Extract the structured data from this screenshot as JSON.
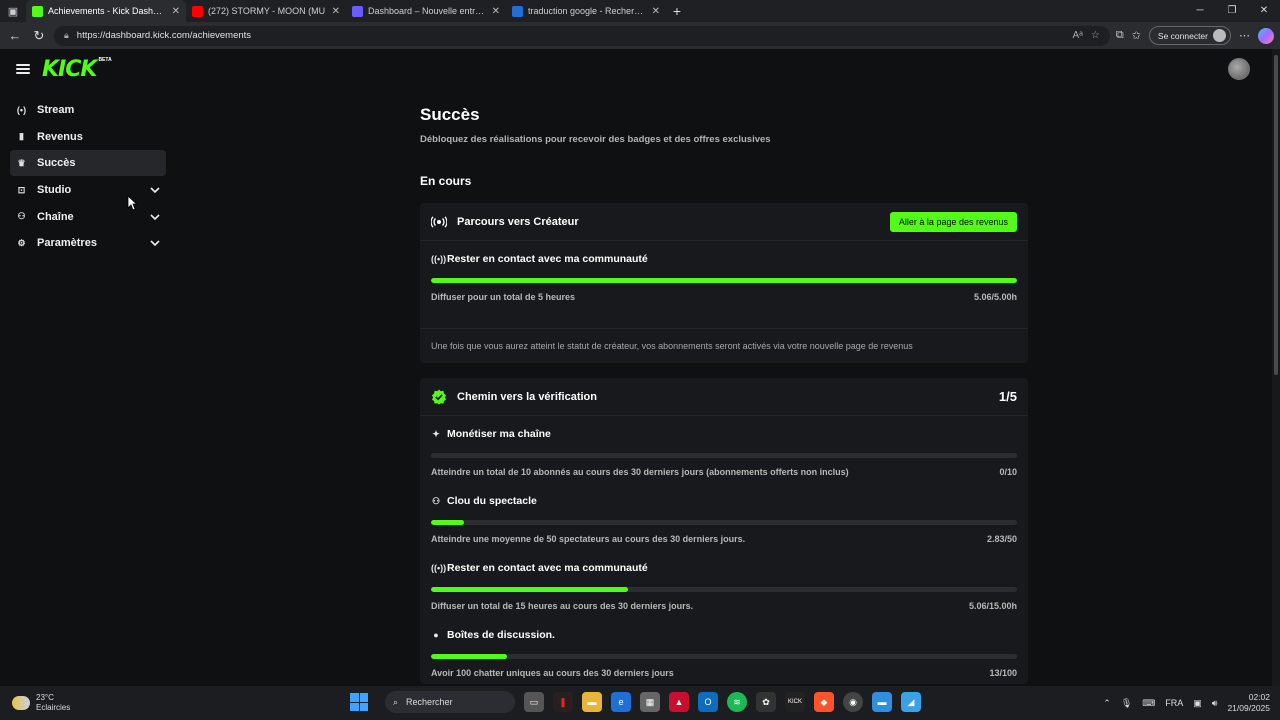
{
  "browser": {
    "tabs": [
      {
        "title": "Achievements - Kick Dashboard",
        "favicon_color": "#53fc18",
        "active": true
      },
      {
        "title": "(272) STORMY - MOON (MU",
        "favicon_color": "#ff0000",
        "active": false
      },
      {
        "title": "Dashboard – Nouvelle entreprise",
        "favicon_color": "#6b5cff",
        "active": false
      },
      {
        "title": "traduction google - Recherche",
        "favicon_color": "#1f6fd6",
        "active": false
      }
    ],
    "url": "https://dashboard.kick.com/achievements",
    "connect_label": "Se connecter"
  },
  "header": {
    "logo": "KICK",
    "logo_badge": "BETA"
  },
  "sidebar": {
    "items": [
      {
        "label": "Stream",
        "icon": "broadcast-icon",
        "glyph": "(•)",
        "active": false,
        "expandable": false
      },
      {
        "label": "Revenus",
        "icon": "chart-icon",
        "glyph": "▮",
        "active": false,
        "expandable": false
      },
      {
        "label": "Succès",
        "icon": "trophy-icon",
        "glyph": "♛",
        "active": true,
        "expandable": false
      },
      {
        "label": "Studio",
        "icon": "studio-icon",
        "glyph": "⊡",
        "active": false,
        "expandable": true
      },
      {
        "label": "Chaîne",
        "icon": "users-icon",
        "glyph": "⚇",
        "active": false,
        "expandable": true
      },
      {
        "label": "Paramètres",
        "icon": "gear-icon",
        "glyph": "⚙",
        "active": false,
        "expandable": true
      }
    ]
  },
  "main": {
    "title": "Succès",
    "subtitle": "Débloquez des réalisations pour recevoir des badges et des offres exclusives",
    "section_title": "En cours",
    "cards": [
      {
        "title": "Parcours vers Créateur",
        "icon": "broadcast-icon",
        "button": "Aller à la page des revenus",
        "count": "",
        "tasks": [
          {
            "title": "Rester en contact avec ma communauté",
            "icon": "broadcast-icon",
            "glyph": "((•))",
            "description": "Diffuser pour un total de 5 heures",
            "progress": "5.06/5.00h",
            "fraction": 1.0
          }
        ],
        "note": "Une fois que vous aurez atteint le statut de créateur, vos abonnements seront activés via votre nouvelle page de revenus"
      },
      {
        "title": "Chemin vers la vérification",
        "icon": "verified-badge-icon",
        "button": "",
        "count": "1/5",
        "tasks": [
          {
            "title": "Monétiser ma chaîne",
            "icon": "sparkle-icon",
            "glyph": "✦",
            "description": "Atteindre un total de 10 abonnés au cours des 30 derniers jours (abonnements offerts non inclus)",
            "progress": "0/10",
            "fraction": 0.0
          },
          {
            "title": "Clou du spectacle",
            "icon": "users-icon",
            "glyph": "⚇",
            "description": "Atteindre une moyenne de 50 spectateurs au cours des 30 derniers jours.",
            "progress": "2.83/50",
            "fraction": 0.057
          },
          {
            "title": "Rester en contact avec ma communauté",
            "icon": "broadcast-icon",
            "glyph": "((•))",
            "description": "Diffuser un total de 15 heures au cours des 30 derniers jours.",
            "progress": "5.06/15.00h",
            "fraction": 0.337
          },
          {
            "title": "Boîtes de discussion.",
            "icon": "chat-icon",
            "glyph": "●",
            "description": "Avoir 100 chatter uniques au cours des 30 derniers jours",
            "progress": "13/100",
            "fraction": 0.13
          }
        ],
        "note": ""
      }
    ]
  },
  "taskbar": {
    "weather_temp": "23°C",
    "weather_desc": "Eclaircies",
    "search_placeholder": "Rechercher",
    "language": "FRA",
    "time": "02:02",
    "date": "21/09/2025"
  },
  "colors": {
    "accent": "#53fc18",
    "background": "#0f1012",
    "card": "#18191c"
  }
}
